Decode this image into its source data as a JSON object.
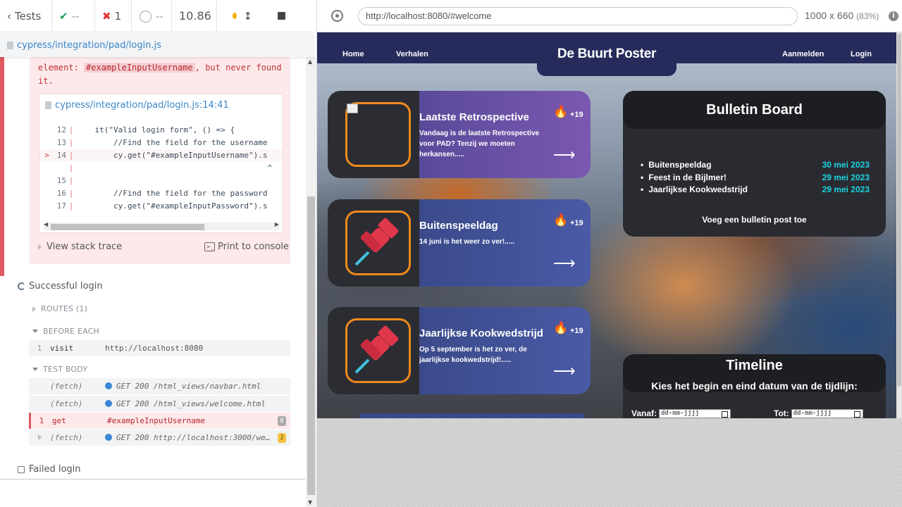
{
  "runner": {
    "tests_label": "Tests",
    "passed": "--",
    "failed": "1",
    "pending": "--",
    "duration": "10.86",
    "spec_path": "cypress/integration/pad/login.js"
  },
  "error": {
    "message_prefix": "element:",
    "selector": "#exampleInputUsername",
    "message_suffix": ", but never found",
    "message_end": "it.",
    "code_file": "cypress/integration/pad/login.js:14:41",
    "code_lines": [
      {
        "arrow": "",
        "num": "12",
        "bar": "|",
        "text": "    it(\"Valid login form\", () => {"
      },
      {
        "arrow": "",
        "num": "13",
        "bar": "|",
        "text": "        //Find the field for the username"
      },
      {
        "arrow": ">",
        "num": "14",
        "bar": "|",
        "text": "        cy.get(\"#exampleInputUsername\").s"
      },
      {
        "arrow": "",
        "num": "",
        "bar": "|",
        "text": "                                         ^"
      },
      {
        "arrow": "",
        "num": "15",
        "bar": "|",
        "text": ""
      },
      {
        "arrow": "",
        "num": "16",
        "bar": "|",
        "text": "        //Find the field for the password"
      },
      {
        "arrow": "",
        "num": "17",
        "bar": "|",
        "text": "        cy.get(\"#exampleInputPassword\").s"
      }
    ],
    "stack_label": "View stack trace",
    "console_label": "Print to console"
  },
  "test_success": {
    "title": "Successful login",
    "routes_label": "ROUTES (1)",
    "before_each_label": "BEFORE EACH",
    "test_body_label": "TEST BODY",
    "commands_before": [
      {
        "n": "1",
        "name": "visit",
        "value": "http://localhost:8080"
      }
    ],
    "commands_body": [
      {
        "n": "",
        "name": "(fetch)",
        "value": "GET 200 /html_views/navbar.html",
        "dot": true,
        "badge": ""
      },
      {
        "n": "",
        "name": "(fetch)",
        "value": "GET 200 /html_views/welcome.html",
        "dot": true,
        "badge": ""
      },
      {
        "n": "1",
        "name": "get",
        "value": "#exampleInputUsername",
        "dot": false,
        "badge": "0"
      },
      {
        "n": "",
        "name": "(fetch)",
        "value": "GET 200 http://localhost:3000/we…",
        "dot": true,
        "badge": "2"
      }
    ]
  },
  "test_failed": {
    "title": "Failed login"
  },
  "aut": {
    "url": "http://localhost:8080/#welcome",
    "viewport": "1000 x 660",
    "scale": "(83%)"
  },
  "site": {
    "nav": {
      "home": "Home",
      "stories": "Verhalen",
      "register": "Aanmelden",
      "login": "Login"
    },
    "brand": "De Buurt Poster",
    "posts": [
      {
        "title": "Laatste Retrospective",
        "desc": "Vandaag is de laatste Retrospective voor PAD? Tenzij we moeten herkansen.....",
        "score": "+19",
        "style": "purple"
      },
      {
        "title": "Buitenspeeldag",
        "desc": "14 juni is het weer zo ver!.....",
        "score": "+19",
        "style": "blue"
      },
      {
        "title": "Jaarlijkse Kookwedstrijd",
        "desc": "Op 5 september is het zo ver, de jaarlijkse kookwedstrijd!.....",
        "score": "+19",
        "style": "blue"
      }
    ],
    "bulletin": {
      "title": "Bulletin Board",
      "items": [
        {
          "name": "Buitenspeeldag",
          "date": "30 mei 2023"
        },
        {
          "name": "Feest in de Bijlmer!",
          "date": "29 mei 2023"
        },
        {
          "name": "Jaarlijkse Kookwedstrijd",
          "date": "29 mei 2023"
        }
      ],
      "add_label": "Voeg een bulletin post toe"
    },
    "timeline": {
      "title": "Timeline",
      "subtitle": "Kies het begin en eind datum van de tijdlijn:",
      "from_label": "Vanaf:",
      "to_label": "Tot:",
      "date_placeholder": "dd-mm-jjjj"
    }
  },
  "colors": {
    "pass": "#1d9c5a",
    "fail": "#e0373a",
    "link": "#3b87c8",
    "nav": "#272b5c",
    "accent_orange": "#f08a1a",
    "date_cyan": "#19d3e0"
  }
}
